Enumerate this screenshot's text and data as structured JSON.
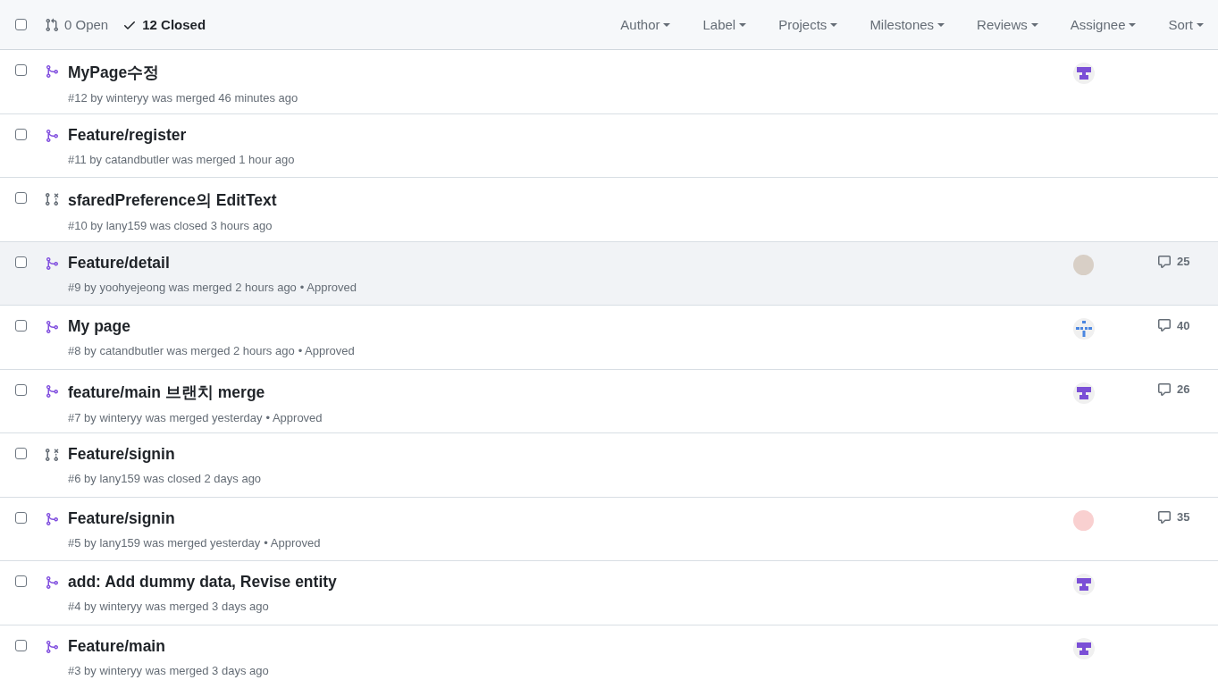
{
  "header": {
    "select_all_checked": false,
    "open": {
      "label": "0 Open",
      "selected": false
    },
    "closed": {
      "label": "12 Closed",
      "selected": true
    },
    "filters": [
      "Author",
      "Label",
      "Projects",
      "Milestones",
      "Reviews",
      "Assignee",
      "Sort"
    ]
  },
  "rows": [
    {
      "checked": false,
      "kind": "merged",
      "highlighted": false,
      "title": "MyPage수정",
      "meta": "#12 by winteryy was merged 46 minutes ago",
      "avatar": {
        "kind": "identicon"
      }
    },
    {
      "checked": false,
      "kind": "merged",
      "highlighted": false,
      "title": "Feature/register",
      "meta": "#11 by catandbutler was merged 1 hour ago"
    },
    {
      "checked": false,
      "kind": "closed",
      "highlighted": false,
      "title": "sfaredPreference의 EditText",
      "meta": "#10 by lany159 was closed 3 hours ago"
    },
    {
      "checked": false,
      "kind": "merged",
      "highlighted": true,
      "title": "Feature/detail",
      "meta": "#9 by yoohyejeong was merged 2 hours ago",
      "review": "• Approved",
      "avatar": {
        "kind": "photo"
      },
      "comments": "25"
    },
    {
      "checked": false,
      "kind": "merged",
      "highlighted": false,
      "title": "My page",
      "meta": "#8 by catandbutler was merged 2 hours ago",
      "review": "• Approved",
      "avatar": {
        "kind": "pattern"
      },
      "comments": "40"
    },
    {
      "checked": false,
      "kind": "merged",
      "highlighted": false,
      "title": "feature/main 브랜치 merge",
      "meta": "#7 by winteryy was merged yesterday",
      "review": "• Approved",
      "avatar": {
        "kind": "identicon"
      },
      "comments": "26"
    },
    {
      "checked": false,
      "kind": "closed",
      "highlighted": false,
      "title": "Feature/signin",
      "meta": "#6 by lany159 was closed 2 days ago"
    },
    {
      "checked": false,
      "kind": "merged",
      "highlighted": false,
      "title": "Feature/signin",
      "meta": "#5 by lany159 was merged yesterday",
      "review": "• Approved",
      "avatar": {
        "kind": "pink"
      },
      "comments": "35"
    },
    {
      "checked": false,
      "kind": "merged",
      "highlighted": false,
      "title": "add: Add dummy data, Revise entity",
      "meta": "#4 by winteryy was merged 3 days ago",
      "avatar": {
        "kind": "identicon"
      }
    },
    {
      "checked": false,
      "kind": "merged",
      "highlighted": false,
      "title": "Feature/main",
      "meta": "#3 by winteryy was merged 3 days ago",
      "avatar": {
        "kind": "identicon"
      }
    }
  ]
}
